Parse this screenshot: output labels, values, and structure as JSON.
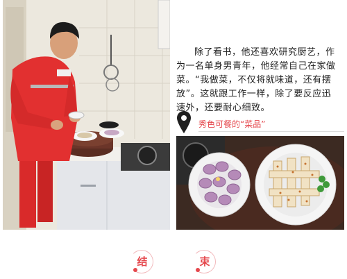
{
  "article": {
    "paragraph": "除了看书，他还喜欢研究厨艺，作为一名单身男青年，他经常自己在家做菜。“我做菜，不仅将就味道，还有摆放”。这就跟工作一样，除了要反应迅速外，还要耐心细致。"
  },
  "caption": {
    "text": "秀色可餐的“菜品”",
    "icon": "map-pin-icon",
    "accent_color": "#e5484d"
  },
  "photos": {
    "left": {
      "icon": "photo-man-cooking"
    },
    "right": {
      "icon": "photo-dishes"
    }
  },
  "footer": {
    "end_chars": [
      "结",
      "束"
    ],
    "accent_color": "#e5484d"
  }
}
